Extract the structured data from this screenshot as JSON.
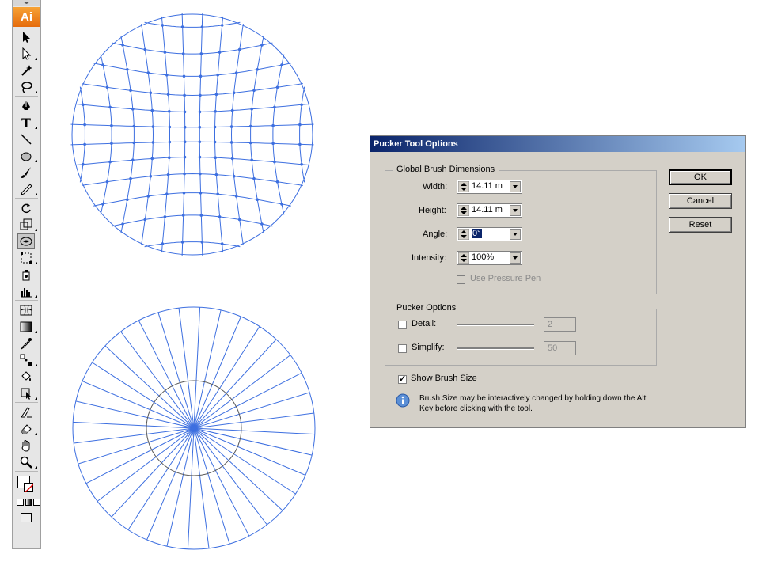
{
  "app": {
    "logo": "Ai"
  },
  "toolbar": {
    "tools": [
      "selection-tool-icon",
      "direct-selection-tool-icon",
      "magic-wand-tool-icon",
      "lasso-tool-icon",
      "pen-tool-icon",
      "type-tool-icon",
      "line-segment-tool-icon",
      "ellipse-tool-icon",
      "paintbrush-tool-icon",
      "pencil-tool-icon",
      "rotate-tool-icon",
      "scale-tool-icon",
      "pucker-tool-icon",
      "free-transform-tool-icon",
      "symbol-sprayer-tool-icon",
      "column-graph-tool-icon",
      "mesh-tool-icon",
      "gradient-tool-icon",
      "eyedropper-tool-icon",
      "blend-tool-icon",
      "live-paint-bucket-tool-icon",
      "live-paint-selection-tool-icon",
      "slice-tool-icon",
      "eraser-tool-icon",
      "hand-tool-icon",
      "zoom-tool-icon"
    ],
    "selected_tool": "pucker-tool-icon"
  },
  "dialog": {
    "title": "Pucker Tool Options",
    "global_brush": {
      "legend": "Global Brush Dimensions",
      "width_label": "Width:",
      "width_value": "14.11 m",
      "height_label": "Height:",
      "height_value": "14.11 m",
      "angle_label": "Angle:",
      "angle_value": "0°",
      "intensity_label": "Intensity:",
      "intensity_value": "100%",
      "pressure_label": "Use Pressure Pen",
      "pressure_checked": false
    },
    "pucker_options": {
      "legend": "Pucker Options",
      "detail_label": "Detail:",
      "detail_value": "2",
      "simplify_label": "Simplify:",
      "simplify_value": "50",
      "detail_checked": false,
      "simplify_checked": false
    },
    "show_brush_size_label": "Show Brush Size",
    "show_brush_size_checked": true,
    "info_text_line1": "Brush Size may be interactively changed by holding down the Alt",
    "info_text_line2": "Key before clicking with the tool.",
    "buttons": {
      "ok": "OK",
      "cancel": "Cancel",
      "reset": "Reset"
    }
  },
  "colors": {
    "artwork_stroke": "#3d6fe0",
    "title_bar_start": "#0a246a",
    "title_bar_end": "#a6caf0",
    "dialog_bg": "#d4d0c8"
  }
}
